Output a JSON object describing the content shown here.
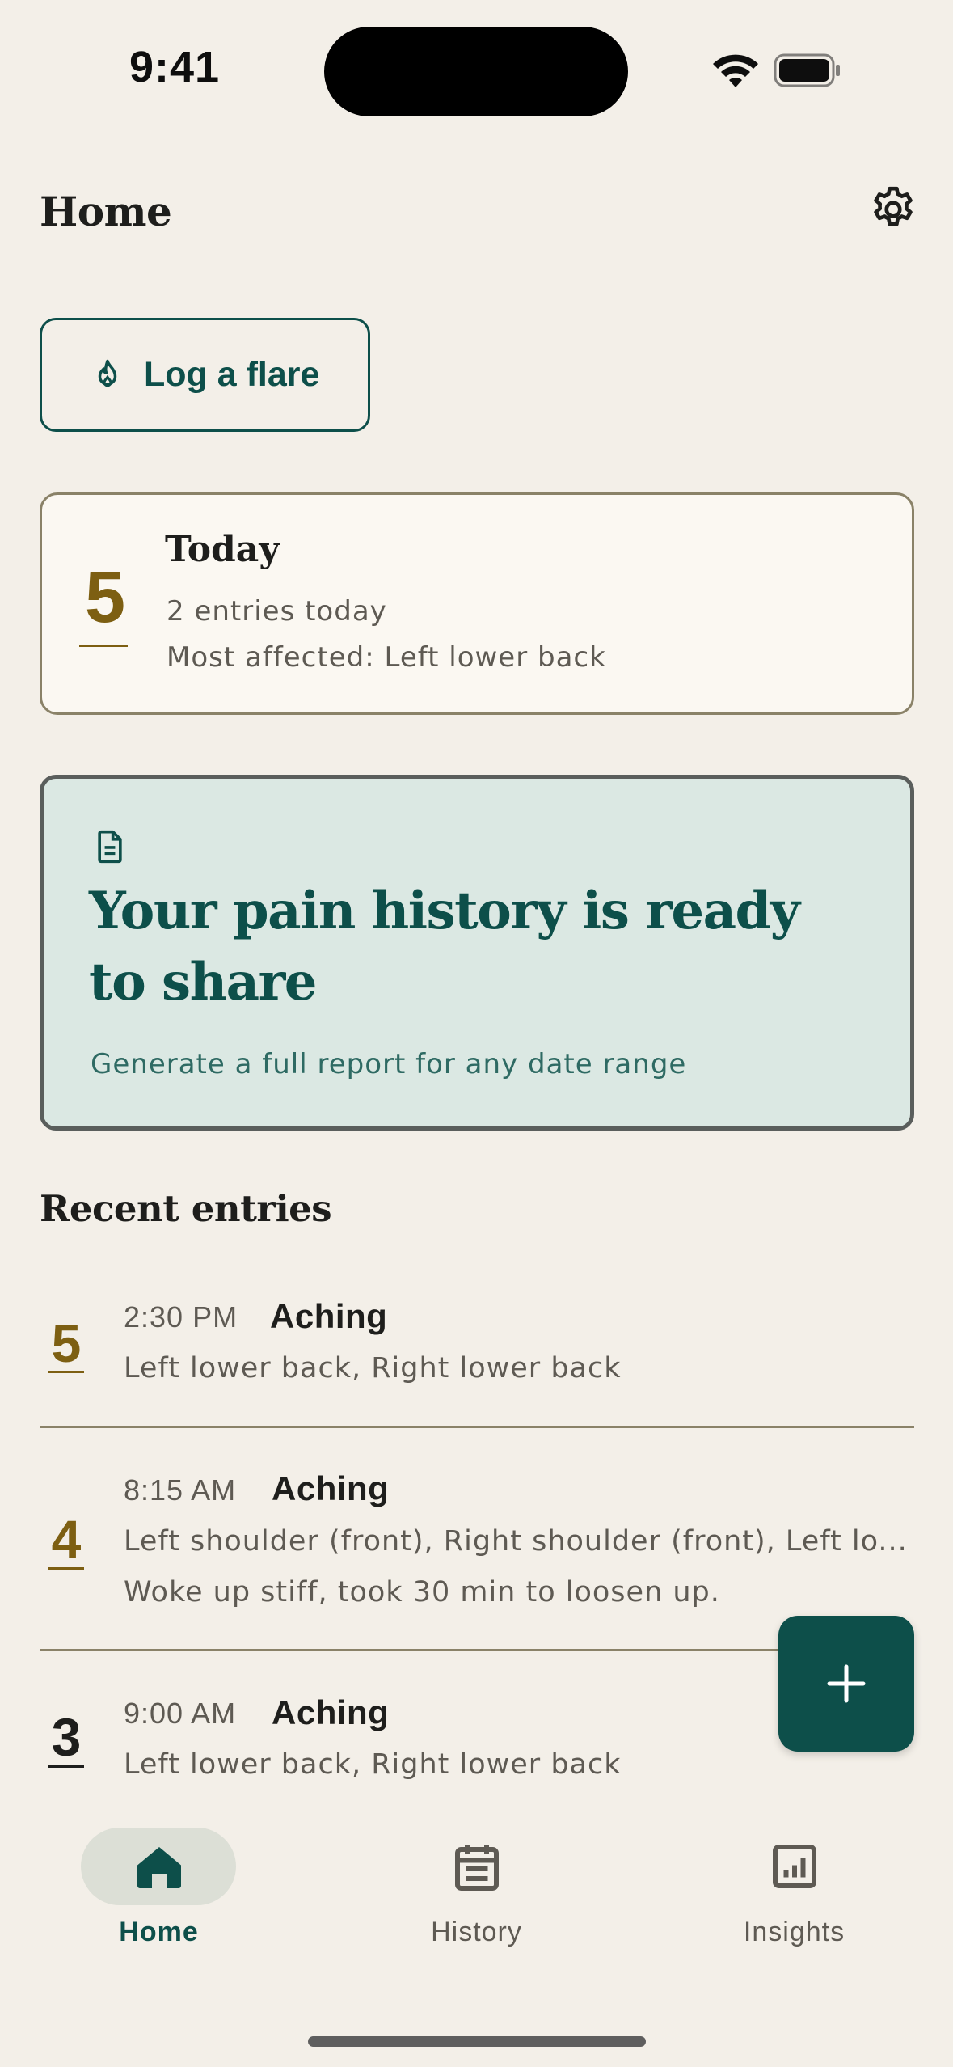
{
  "status_bar": {
    "time": "9:41"
  },
  "header": {
    "title": "Home",
    "settings_icon": "gear-icon"
  },
  "log_flare": {
    "label": "Log a flare",
    "icon": "flame-icon"
  },
  "today": {
    "score": "5",
    "title": "Today",
    "entries_text": "2 entries today",
    "most_affected": "Most affected: Left lower back"
  },
  "report": {
    "icon": "document-icon",
    "title": "Your pain history is ready to share",
    "subtitle": "Generate a full report for any date range"
  },
  "recent": {
    "title": "Recent entries",
    "entries": [
      {
        "score": "5",
        "time": "2:30 PM",
        "quality": "Aching",
        "locations": "Left lower back, Right lower back",
        "note": ""
      },
      {
        "score": "4",
        "time": "8:15 AM",
        "quality": "Aching",
        "locations": "Left shoulder (front), Right shoulder (front), Left lo...",
        "note": "Woke up stiff, took 30 min to loosen up."
      },
      {
        "score": "3",
        "time": "9:00 AM",
        "quality": "Aching",
        "locations": "Left lower back, Right lower back",
        "note": ""
      }
    ]
  },
  "fab": {
    "icon": "plus-icon"
  },
  "nav": {
    "items": [
      {
        "label": "Home",
        "icon": "home-icon",
        "active": true
      },
      {
        "label": "History",
        "icon": "calendar-icon",
        "active": false
      },
      {
        "label": "Insights",
        "icon": "chart-icon",
        "active": false
      }
    ]
  },
  "colors": {
    "background": "#F3EFE8",
    "accent": "#0D4F4A",
    "score_gold": "#7D5F12",
    "score_dark": "#1E1E1C",
    "card_border": "#8A8268",
    "report_bg": "#DBE8E3"
  }
}
